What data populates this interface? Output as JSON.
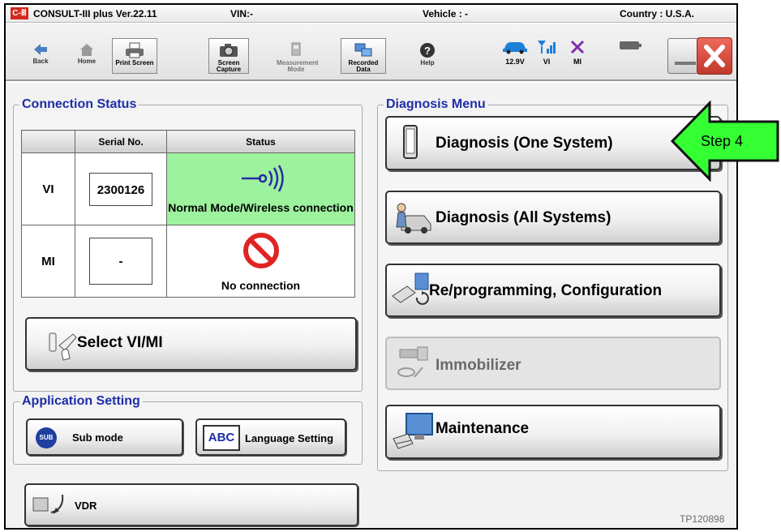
{
  "title_bar": {
    "app": "CONSULT-III plus  Ver.22.11",
    "vin": "VIN:-",
    "vehicle": "Vehicle : -",
    "country": "Country : U.S.A."
  },
  "toolbar": {
    "back": "Back",
    "home": "Home",
    "print_screen": "Print Screen",
    "screen_capture_1": "Screen",
    "screen_capture_2": "Capture",
    "measurement_1": "Measurement",
    "measurement_2": "Mode",
    "recorded_1": "Recorded",
    "recorded_2": "Data",
    "help": "Help"
  },
  "status_icons": {
    "voltage": "12.9V",
    "vi": "VI",
    "mi": "MI"
  },
  "connection_status": {
    "title": "Connection Status",
    "col_serial": "Serial No.",
    "col_status": "Status",
    "rows": [
      {
        "device": "VI",
        "serial": "2300126",
        "status": "Normal Mode/Wireless connection"
      },
      {
        "device": "MI",
        "serial": "-",
        "status": "No connection"
      }
    ]
  },
  "select_vi_mi": "Select VI/MI",
  "application_setting": {
    "title": "Application Setting",
    "sub_mode": "Sub mode",
    "sub_icon": "SUB",
    "language_setting": "Language Setting",
    "abc_icon": "ABC",
    "vdr": "VDR"
  },
  "diagnosis_menu": {
    "title": "Diagnosis Menu",
    "one_system": "Diagnosis (One System)",
    "all_systems": "Diagnosis (All Systems)",
    "reprogramming": "Re/programming, Configuration",
    "immobilizer": "Immobilizer",
    "maintenance": "Maintenance"
  },
  "callout": "Step 4",
  "figure_id": "TP120898",
  "colors": {
    "section_title": "#1e2ea8",
    "connected": "#9df29d",
    "callout": "#33ff33",
    "close": "#c0392b"
  }
}
